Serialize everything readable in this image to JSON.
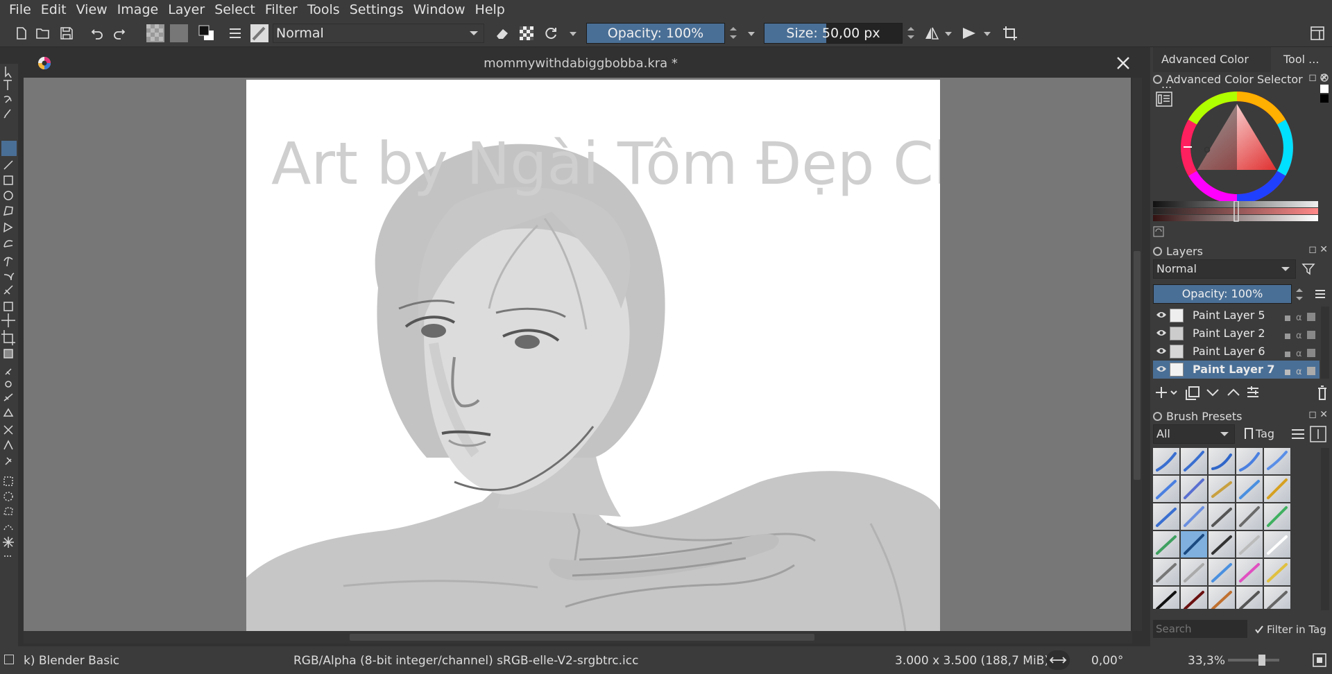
{
  "menu": [
    "File",
    "Edit",
    "View",
    "Image",
    "Layer",
    "Select",
    "Filter",
    "Tools",
    "Settings",
    "Window",
    "Help"
  ],
  "toolbar": {
    "blend_mode": "Normal",
    "opacity_label": "Opacity: 100%",
    "opacity_value": 100,
    "size_label": "Size: 50,00 px",
    "size_value_fraction": 0.45
  },
  "document": {
    "title": "mommywithdabiggbobba.kra *",
    "watermark": "Art by Ngài Tôm Đẹp Chai"
  },
  "dock": {
    "tabs": [
      "Advanced Color ...",
      "Tool ..."
    ],
    "color_panel_title": "Advanced Color Selector",
    "layers_panel_title": "Layers",
    "layers_blend": "Normal",
    "layers_opacity_label": "Opacity:  100%",
    "layers": [
      {
        "name": "Paint Layer 5",
        "active": false
      },
      {
        "name": "Paint Layer 2",
        "active": false
      },
      {
        "name": "Paint Layer 6",
        "active": false
      },
      {
        "name": "Paint Layer 7",
        "active": true
      }
    ],
    "brush_panel_title": "Brush Presets",
    "brush_filter": "All",
    "brush_tag": "Tag",
    "search_placeholder": "Search",
    "filter_in_tag": "Filter in Tag"
  },
  "status": {
    "brush_name": "k) Blender Basic",
    "color_space": "RGB/Alpha (8-bit integer/channel)  sRGB-elle-V2-srgbtrc.icc",
    "image_size": "3.000 x 3.500 (188,7 MiB)",
    "rotation": "0,00°",
    "zoom": "33,3%"
  },
  "colors": {
    "accent": "#4a6f96",
    "panel": "#3b3b3b",
    "background": "#313131",
    "canvas_bg": "#777777"
  }
}
